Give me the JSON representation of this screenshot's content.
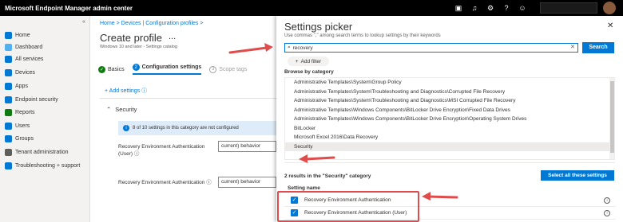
{
  "app": {
    "title": "Microsoft Endpoint Manager admin center"
  },
  "topbar": {
    "icons": [
      "screen-icon",
      "bell-icon",
      "gear-icon",
      "help-icon",
      "feedback-icon"
    ]
  },
  "sidebar": {
    "collapse": "«",
    "items": [
      {
        "label": "Home",
        "color": "#0078d4"
      },
      {
        "label": "Dashboard",
        "color": "#50b0f0"
      },
      {
        "label": "All services",
        "color": "#0078d4"
      },
      {
        "label": "Devices",
        "color": "#0078d4"
      },
      {
        "label": "Apps",
        "color": "#0078d4"
      },
      {
        "label": "Endpoint security",
        "color": "#0078d4"
      },
      {
        "label": "Reports",
        "color": "#107c10"
      },
      {
        "label": "Users",
        "color": "#0078d4"
      },
      {
        "label": "Groups",
        "color": "#0078d4"
      },
      {
        "label": "Tenant administration",
        "color": "#605e5c"
      },
      {
        "label": "Troubleshooting + support",
        "color": "#0078d4"
      }
    ]
  },
  "main": {
    "breadcrumb": "Home > Devices | Configuration profiles >",
    "title": "Create profile",
    "more": "...",
    "subtitle": "Windows 10 and later - Settings catalog",
    "steps": [
      {
        "num": "✓",
        "label": "Basics"
      },
      {
        "num": "2",
        "label": "Configuration settings"
      },
      {
        "num": "3",
        "label": "Scope tags"
      }
    ],
    "add_settings": "+ Add settings ⓘ",
    "security_head": "Security",
    "info_text": "8 of 10 settings in this category are not configured",
    "settings": [
      {
        "label": "Recovery Environment Authentication (User) ⓘ",
        "value": "current) behavior"
      },
      {
        "label": "Recovery Environment Authentication ⓘ",
        "value": "current) behavior"
      }
    ]
  },
  "picker": {
    "title": "Settings picker",
    "hint": "Use commas \",\" among search terms to lookup settings by their keywords",
    "search_value": "recovery",
    "search_button": "Search",
    "add_filter": "Add filter",
    "browse_head": "Browse by category",
    "categories": [
      "Administrative Templates\\System\\Group Policy",
      "Administrative Templates\\System\\Troubleshooting and Diagnostics\\Corrupted File Recovery",
      "Administrative Templates\\System\\Troubleshooting and Diagnostics\\MSI Corrupted File Recovery",
      "Administrative Templates\\Windows Components\\BitLocker Drive Encryption\\Fixed Data Drives",
      "Administrative Templates\\Windows Components\\BitLocker Drive Encryption\\Operating System Drives",
      "BitLocker",
      "Microsoft Excel 2016\\Data Recovery",
      "Security"
    ],
    "selected_category": "Security",
    "results_head": "2 results in the \"Security\" category",
    "select_all": "Select all these settings",
    "col_head": "Setting name",
    "results": [
      "Recovery Environment Authentication",
      "Recovery Environment Authentication (User)"
    ]
  },
  "accent": "#0078d4",
  "highlight": "#e04c4c"
}
